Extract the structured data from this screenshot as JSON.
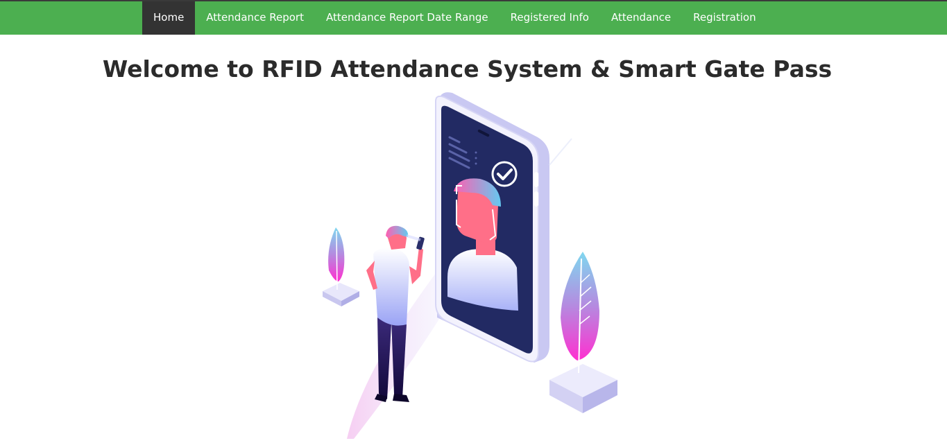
{
  "nav": {
    "items": [
      {
        "label": "Home",
        "active": true
      },
      {
        "label": "Attendance Report",
        "active": false
      },
      {
        "label": "Attendance Report Date Range",
        "active": false
      },
      {
        "label": "Registered Info",
        "active": false
      },
      {
        "label": "Attendance",
        "active": false
      },
      {
        "label": "Registration",
        "active": false
      }
    ]
  },
  "page": {
    "title": "Welcome to RFID Attendance System & Smart Gate Pass"
  },
  "hero": {
    "icon": "face-recognition-illustration"
  },
  "colors": {
    "navbar": "#4caf50",
    "nav_active": "#333333",
    "nav_text": "#ffffff",
    "title": "#2b2b2b",
    "phone_screen": "#222a63",
    "accent_pink": "#ff3cc7",
    "accent_blue": "#79d7f0"
  }
}
